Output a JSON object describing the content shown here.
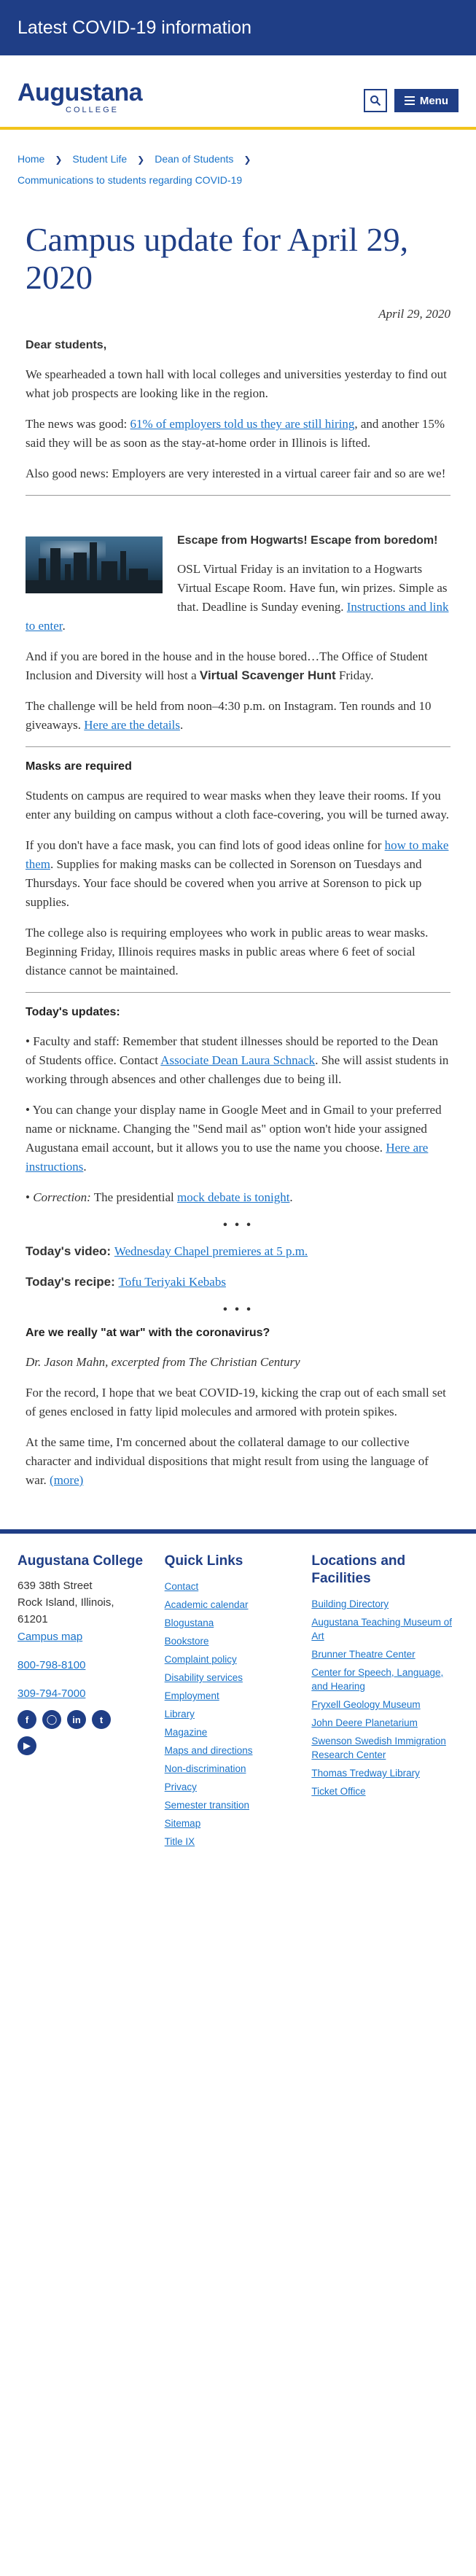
{
  "covid_bar": {
    "text": "Latest COVID-19 information"
  },
  "header": {
    "logo_main": "Augustana",
    "logo_sub": "COLLEGE",
    "menu_label": "Menu"
  },
  "breadcrumb": {
    "items": [
      "Home",
      "Student Life",
      "Dean of Students",
      "Communications to students regarding COVID-19"
    ]
  },
  "article": {
    "title": "Campus update for April 29, 2020",
    "date": "April 29, 2020",
    "greeting": "Dear students,",
    "p1": "We spearheaded a town hall with local colleges and universities yesterday to find out what job prospects are looking like in the region.",
    "p2_pre": "The news was good: ",
    "p2_link": "61% of employers told us they are still hiring",
    "p2_post": ", and another 15% said they will be as soon as the stay-at-home order in Illinois is lifted.",
    "p3": "Also good news: Employers are very interested in a virtual career fair and so are we!",
    "hog_title": "Escape from Hogwarts! Escape from boredom!",
    "hog_p1_pre": "OSL Virtual Friday is an invitation to a Hogwarts Virtual Escape Room. Have fun, win prizes. Simple as that. Deadline is Sunday evening. ",
    "hog_p1_link": "Instructions and link to enter",
    "hog_p1_post": ".",
    "hunt_pre": "And if you are bored in the house and in the house bored…The Office of Student Inclusion and Diversity will host a ",
    "hunt_bold": "Virtual Scavenger Hunt",
    "hunt_post": " Friday.",
    "challenge_pre": "The challenge will be held from noon–4:30 p.m. on Instagram. Ten rounds and 10 giveaways. ",
    "challenge_link": "Here are the details",
    "challenge_post": ".",
    "masks_heading": "Masks are required",
    "masks_p1": "Students on campus are required to wear masks when they leave their rooms. If you enter any building on campus without a cloth face-covering, you will be turned away.",
    "masks_p2_pre": "If you don't have a face mask, you can find lots of good ideas online for ",
    "masks_p2_link": "how to make them",
    "masks_p2_post": ". Supplies for making masks can be collected in Sorenson on Tuesdays and Thursdays. Your face should be covered when you arrive at Sorenson to pick up supplies.",
    "masks_p3": "The college also is requiring employees who work in public areas to wear masks. Beginning Friday, Illinois requires masks in public areas where 6 feet of social distance cannot be maintained.",
    "updates_heading": "Today's updates:",
    "u1_pre": "• Faculty and staff: Remember that student illnesses should be reported to the Dean of Students office. Contact ",
    "u1_link": "Associate Dean Laura Schnack",
    "u1_post": ". She will assist students in working through absences and other challenges due to being ill.",
    "u2_pre": "• You can change your display name in Google Meet and in Gmail to your preferred name or nickname. Changing the \"Send mail as\" option won't hide your assigned Augustana email account, but it allows you to use the name you choose. ",
    "u2_link": "Here are instructions",
    "u2_post": ".",
    "u3_bullet": "• ",
    "u3_em": "Correction:",
    "u3_pre": " The presidential ",
    "u3_link": "mock debate is tonight",
    "u3_post": ".",
    "dots": "• • •",
    "video_label": "Today's video: ",
    "video_link": "Wednesday Chapel premieres at 5 p.m.",
    "recipe_label": "Today's recipe: ",
    "recipe_link": "Tofu Teriyaki Kebabs",
    "war_heading": "Are we really \"at war\" with the coronavirus?",
    "war_byline_pre": "Dr. Jason Mahn, excerpted from ",
    "war_byline_title": "The Christian Century",
    "war_p1": "For the record, I hope that we beat COVID-19, kicking the crap out of each small set of genes enclosed in fatty lipid molecules and armored with protein spikes.",
    "war_p2_pre": "At the same time, I'm concerned about the collateral damage to our collective character and individual dispositions that might result from using the language of war. ",
    "war_p2_link": "(more)"
  },
  "footer": {
    "col1_title": "Augustana College",
    "address1": "639 38th Street",
    "address2": "Rock Island, Illinois,",
    "address3": "61201",
    "campus_map": "Campus map",
    "phone1": "800-798-8100",
    "phone2": "309-794-7000",
    "col2_title": "Quick Links",
    "quick_links": [
      "Contact",
      "Academic calendar",
      "Blogustana",
      "Bookstore",
      "Complaint policy",
      "Disability services",
      "Employment",
      "Library",
      "Magazine",
      "Maps and directions",
      "Non-discrimination",
      "Privacy",
      "Semester transition",
      "Sitemap",
      "Title IX"
    ],
    "col3_title": "Locations and Facilities",
    "locations": [
      "Building Directory",
      "Augustana Teaching Museum of Art",
      "Brunner Theatre Center",
      "Center for Speech, Language, and Hearing",
      "Fryxell Geology Museum",
      "John Deere Planetarium",
      "Swenson Swedish Immigration Research Center",
      "Thomas Tredway Library",
      "Ticket Office"
    ],
    "social_icons": [
      "facebook-icon",
      "instagram-icon",
      "linkedin-icon",
      "twitter-icon",
      "youtube-icon"
    ]
  },
  "colors": {
    "brand_blue": "#1f3e86",
    "gold": "#f2c41c",
    "link": "#1a73c9"
  }
}
